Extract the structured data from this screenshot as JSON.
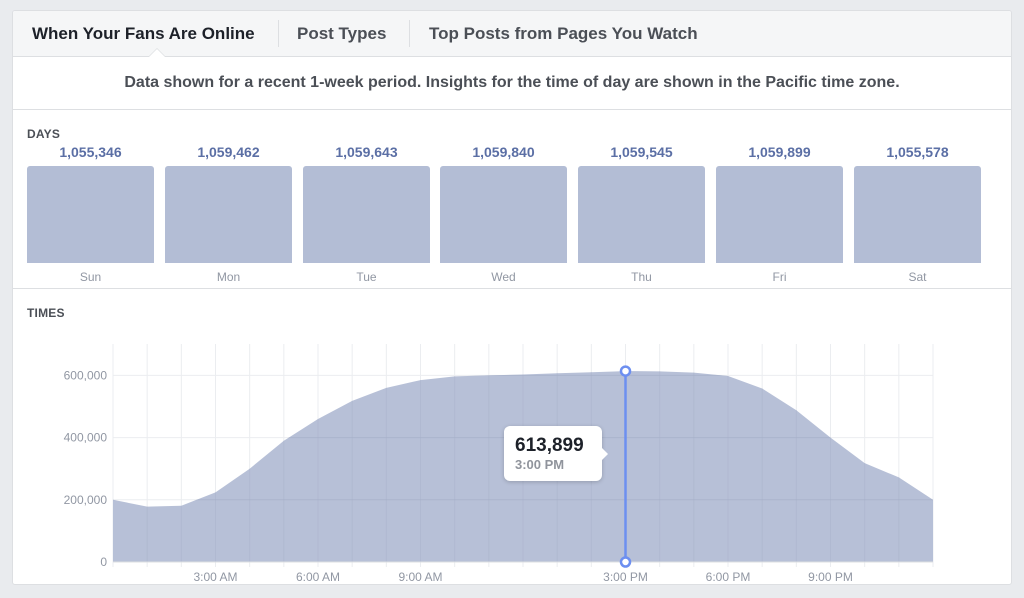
{
  "tabs": [
    {
      "label": "When Your Fans Are Online",
      "active": true
    },
    {
      "label": "Post Types",
      "active": false
    },
    {
      "label": "Top Posts from Pages You Watch",
      "active": false
    }
  ],
  "info_text": "Data shown for a recent 1-week period. Insights for the time of day are shown in the Pacific time zone.",
  "days_section": {
    "label": "DAYS",
    "days": [
      {
        "name": "Sun",
        "value": "1,055,346"
      },
      {
        "name": "Mon",
        "value": "1,059,462"
      },
      {
        "name": "Tue",
        "value": "1,059,643"
      },
      {
        "name": "Wed",
        "value": "1,059,840"
      },
      {
        "name": "Thu",
        "value": "1,059,545"
      },
      {
        "name": "Fri",
        "value": "1,059,899"
      },
      {
        "name": "Sat",
        "value": "1,055,578"
      }
    ]
  },
  "times_section": {
    "label": "TIMES",
    "tooltip": {
      "value": "613,899",
      "time": "3:00 PM"
    }
  },
  "colors": {
    "area_fill": "#b3bdd5",
    "day_value": "#5b6fa5",
    "hover_line": "#6d8ff0",
    "grid": "#ebedf0"
  },
  "chart_data": [
    {
      "type": "bar",
      "title": "DAYS",
      "categories": [
        "Sun",
        "Mon",
        "Tue",
        "Wed",
        "Thu",
        "Fri",
        "Sat"
      ],
      "values": [
        1055346,
        1059462,
        1059643,
        1059840,
        1059545,
        1059899,
        1055578
      ],
      "xlabel": "",
      "ylabel": ""
    },
    {
      "type": "area",
      "title": "TIMES",
      "x": [
        "12:00 AM",
        "1:00 AM",
        "2:00 AM",
        "3:00 AM",
        "4:00 AM",
        "5:00 AM",
        "6:00 AM",
        "7:00 AM",
        "8:00 AM",
        "9:00 AM",
        "10:00 AM",
        "11:00 AM",
        "12:00 PM",
        "1:00 PM",
        "2:00 PM",
        "3:00 PM",
        "4:00 PM",
        "5:00 PM",
        "6:00 PM",
        "7:00 PM",
        "8:00 PM",
        "9:00 PM",
        "10:00 PM",
        "11:00 PM",
        "12:00 AM"
      ],
      "values": [
        200000,
        178000,
        181000,
        224000,
        300000,
        390000,
        460000,
        518000,
        560000,
        585000,
        597000,
        600000,
        603000,
        607000,
        610000,
        613899,
        613000,
        609000,
        598000,
        558000,
        488000,
        400000,
        318000,
        272000,
        200000
      ],
      "x_tick_labels": [
        {
          "index": 3,
          "label": "3:00 AM"
        },
        {
          "index": 6,
          "label": "6:00 AM"
        },
        {
          "index": 9,
          "label": "9:00 AM"
        },
        {
          "index": 15,
          "label": "3:00 PM"
        },
        {
          "index": 18,
          "label": "6:00 PM"
        },
        {
          "index": 21,
          "label": "9:00 PM"
        }
      ],
      "y_ticks": [
        0,
        200000,
        400000,
        600000
      ],
      "y_tick_labels": [
        "0",
        "200,000",
        "400,000",
        "600,000"
      ],
      "ylim": [
        0,
        700000
      ],
      "grid": true,
      "highlight_index": 15,
      "xlabel": "",
      "ylabel": ""
    }
  ]
}
